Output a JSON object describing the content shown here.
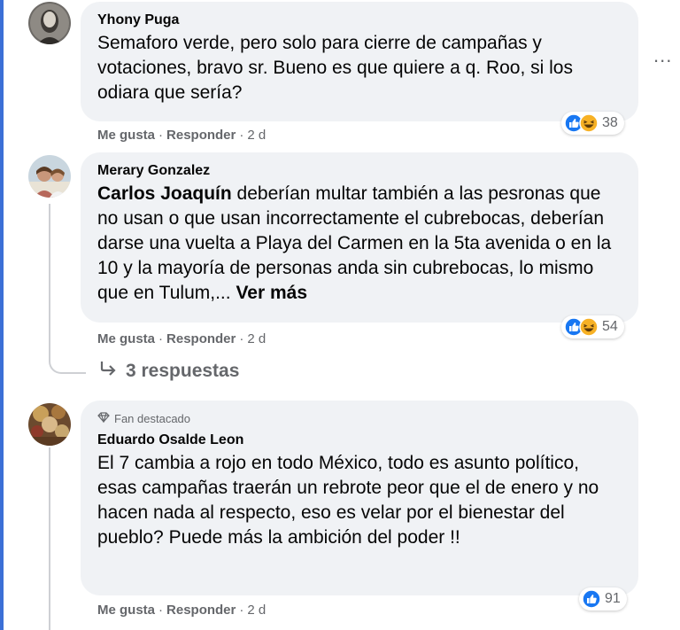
{
  "comments": [
    {
      "author": "Yhony Puga",
      "text": "Semaforo verde, pero solo para cierre de campañas y votaciones, bravo sr. Bueno es que quiere a q. Roo, si los odiara que sería?",
      "reaction_count": "38",
      "reaction_icons": [
        "like-icon",
        "haha-icon"
      ],
      "actions": {
        "like": "Me gusta",
        "reply": "Responder",
        "time": "2 d"
      }
    },
    {
      "author": "Merary Gonzalez",
      "mention": "Carlos Joaquín",
      "text": " deberían multar también a las pesronas que no usan o que usan incorrectamente el cubrebocas, deberían darse una vuelta a Playa del Carmen en la 5ta avenida o en la 10 y la mayoría de personas anda sin cubrebocas, lo mismo que en Tulum,... ",
      "see_more": "Ver más",
      "reaction_count": "54",
      "reaction_icons": [
        "like-icon",
        "haha-icon"
      ],
      "actions": {
        "like": "Me gusta",
        "reply": "Responder",
        "time": "2 d"
      },
      "replies_label": "3 respuestas"
    },
    {
      "badge": "Fan destacado",
      "author": "Eduardo Osalde Leon",
      "text": "El 7 cambia a rojo en todo México, todo es asunto político, esas campañas traerán un rebrote peor que el de enero y no hacen nada al respecto, eso es velar por el bienestar del pueblo? Puede más la ambición del poder !!",
      "reaction_count": "91",
      "reaction_icons": [
        "like-icon"
      ],
      "actions": {
        "like": "Me gusta",
        "reply": "Responder",
        "time": "2 d"
      }
    }
  ],
  "more_options": "...",
  "separator": "·",
  "colors": {
    "like_blue": "#1877f2",
    "haha_yellow": "#f7b125",
    "frame_blue": "#3b6fd6",
    "bubble_gray": "#f0f2f5",
    "meta_gray": "#65676b"
  }
}
